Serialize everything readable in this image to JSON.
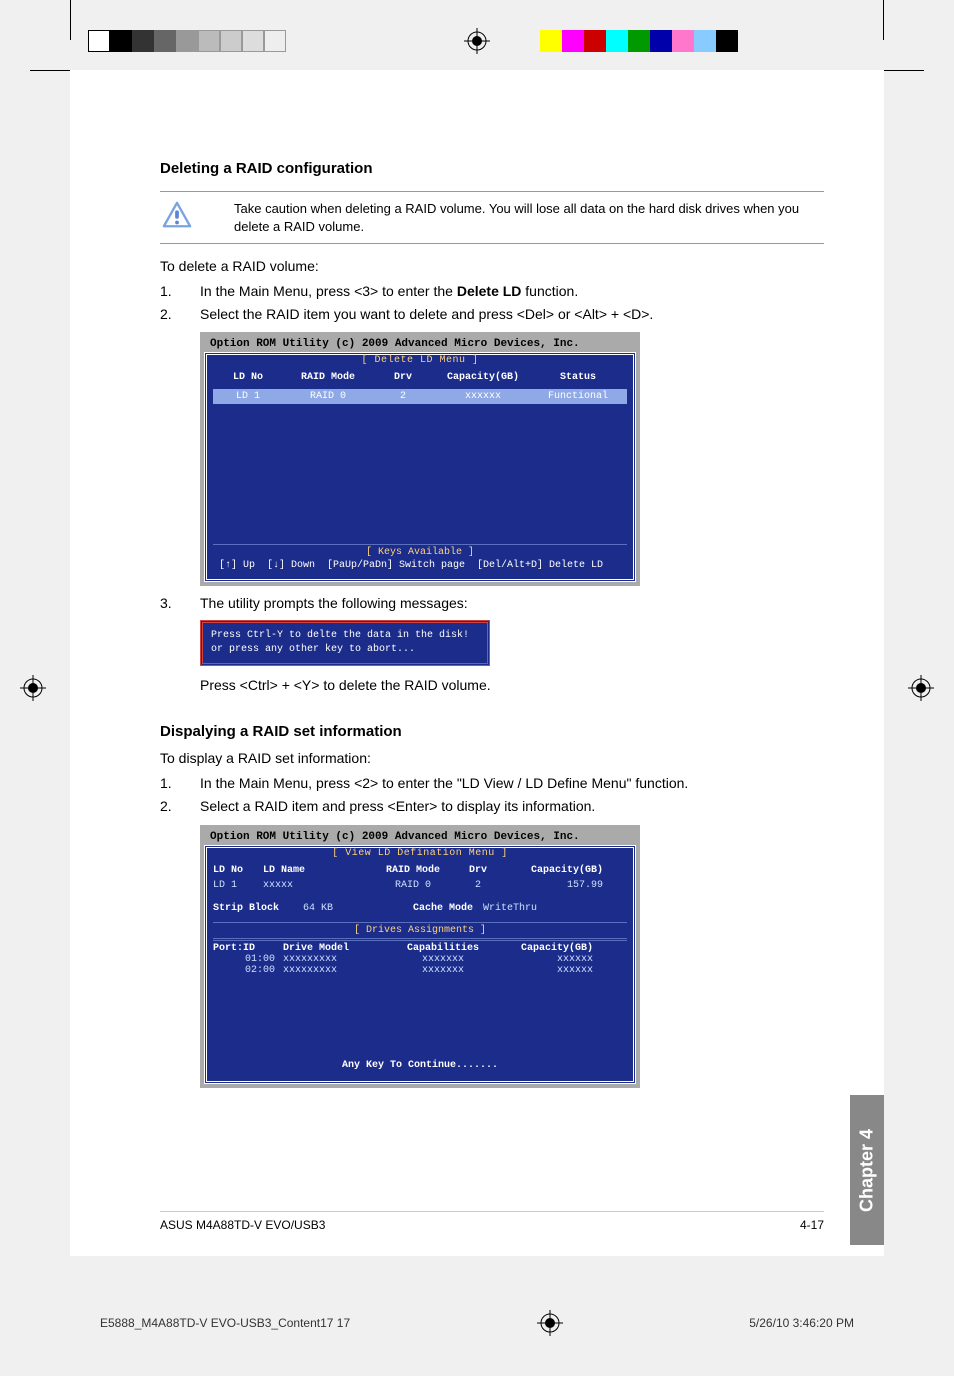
{
  "headings": {
    "h1": "Deleting a RAID configuration",
    "h2": "Dispalying a RAID set information"
  },
  "caution": "Take caution when deleting a RAID volume. You will lose all data on the hard disk drives when you delete a RAID volume.",
  "delete_intro": "To delete a RAID volume:",
  "delete_steps": {
    "s1_pre": "In the Main Menu, press <3> to enter the ",
    "s1_bold": "Delete LD",
    "s1_post": " function.",
    "s2": "Select the RAID item you want to delete and press <Del> or <Alt> + <D>.",
    "s3": "The utility prompts the following messages:",
    "s3_after": "Press <Ctrl> + <Y> to delete the RAID volume."
  },
  "display_intro": "To display a RAID set information:",
  "display_steps": {
    "s1": "In the Main Menu, press <2> to enter the \"LD View / LD Define Menu\" function.",
    "s2": "Select a RAID item and press <Enter> to display its information."
  },
  "bios1": {
    "title": "Option ROM Utility (c) 2009 Advanced Micro Devices, Inc.",
    "menu_label": "[ Delete LD Menu ]",
    "cols": {
      "c1": "LD No",
      "c2": "RAID Mode",
      "c3": "Drv",
      "c4": "Capacity(GB)",
      "c5": "Status"
    },
    "row1": {
      "c1": "LD  1",
      "c2": "RAID 0",
      "c3": "2",
      "c4": "xxxxxx",
      "c5": "Functional"
    },
    "keys_label": "[ Keys Available ]",
    "keys_row": "[↑] Up  [↓] Down  [PaUp/PaDn] Switch page  [Del/Alt+D] Delete LD"
  },
  "prompt": {
    "l1": "Press Ctrl-Y to delte the data in the disk!",
    "l2": "or press any other key to abort..."
  },
  "bios2": {
    "title": "Option ROM Utility (c) 2009 Advanced Micro Devices, Inc.",
    "menu_label": "[ View LD Defination Menu ]",
    "cols": {
      "c1": "LD No",
      "c2": "LD Name",
      "c3": "RAID Mode",
      "c4": "Drv",
      "c5": "Capacity(GB)"
    },
    "row1": {
      "c1": "LD  1",
      "c2": "xxxxx",
      "c3": "RAID 0",
      "c4": "2",
      "c5": "157.99"
    },
    "strip_label": "Strip Block",
    "strip_val": "64 KB",
    "cache_label": "Cache Mode",
    "cache_val": "WriteThru",
    "da_label": "[ Drives Assignments ]",
    "da_cols": {
      "d1": "Port:ID",
      "d2": "Drive Model",
      "d3": "Capabilities",
      "d4": "Capacity(GB)"
    },
    "da_rows": [
      {
        "d1": "01:00",
        "d2": "xxxxxxxxx",
        "d3": "xxxxxxx",
        "d4": "xxxxxx"
      },
      {
        "d1": "02:00",
        "d2": "xxxxxxxxx",
        "d3": "xxxxxxx",
        "d4": "xxxxxx"
      }
    ],
    "anykey": "Any Key To Continue......."
  },
  "chapter_tab": "Chapter 4",
  "footer": {
    "left": "ASUS M4A88TD-V EVO/USB3",
    "right": "4-17"
  },
  "slug": {
    "left": "E5888_M4A88TD-V EVO-USB3_Content17   17",
    "right": "5/26/10   3:46:20 PM"
  }
}
